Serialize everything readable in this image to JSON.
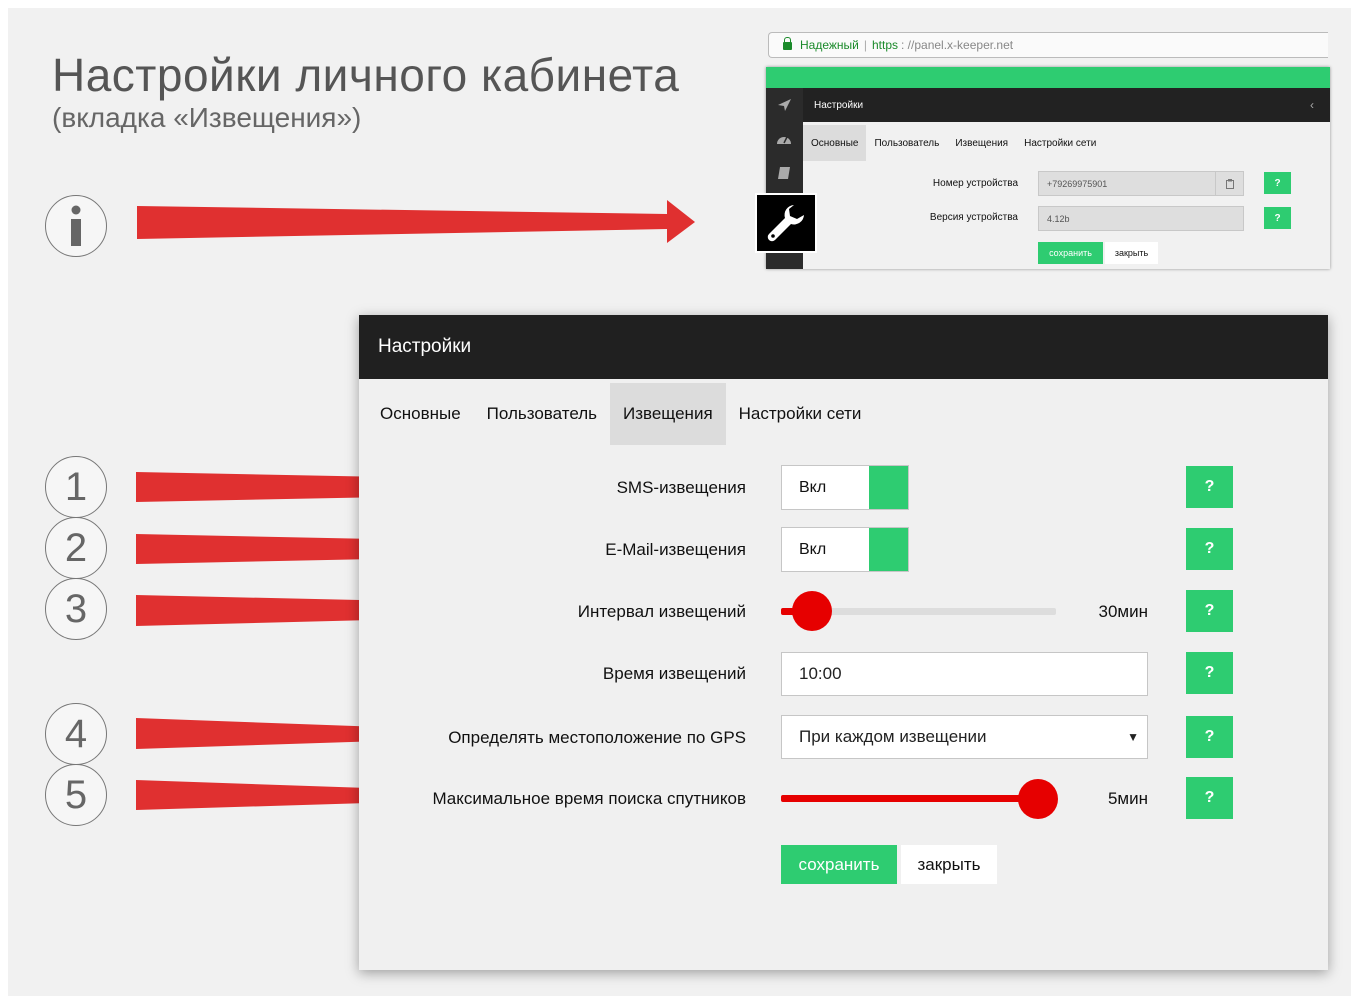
{
  "heading": {
    "title": "Настройки личного кабинета",
    "subtitle": "(вкладка «Извещения»)"
  },
  "markers": {
    "info": "i",
    "steps": [
      "1",
      "2",
      "3",
      "4",
      "5"
    ]
  },
  "browser": {
    "secure_label": "Надежный",
    "separator": "|",
    "protocol": "https",
    "host": ": //panel.x-keeper.net"
  },
  "mini_panel": {
    "title": "Настройки",
    "tabs": [
      {
        "label": "Основные",
        "active": true
      },
      {
        "label": "Пользователь",
        "active": false
      },
      {
        "label": "Извещения",
        "active": false
      },
      {
        "label": "Настройки сети",
        "active": false
      }
    ],
    "device_number_label": "Номер устройства",
    "device_number_value": "+79269975901",
    "device_version_label": "Версия устройства",
    "device_version_value": "4.12b",
    "help_label": "?",
    "save_label": "сохранить",
    "close_label": "закрыть"
  },
  "panel": {
    "title": "Настройки",
    "tabs": [
      {
        "label": "Основные",
        "active": false
      },
      {
        "label": "Пользователь",
        "active": false
      },
      {
        "label": "Извещения",
        "active": true
      },
      {
        "label": "Настройки сети",
        "active": false
      }
    ],
    "sms": {
      "label": "SMS-извещения",
      "value": "Вкл"
    },
    "email": {
      "label": "E-Mail-извещения",
      "value": "Вкл"
    },
    "interval": {
      "label": "Интервал извещений",
      "value_text": "30мин",
      "level": 0.0
    },
    "time": {
      "label": "Время извещений",
      "value": "10:00"
    },
    "gps": {
      "label": "Определять местоположение по GPS",
      "selected": "При каждом извещении"
    },
    "max_search": {
      "label": "Максимальное время поиска спутников",
      "value_text": "5мин",
      "level": 1.0
    },
    "help_label": "?",
    "save_label": "сохранить",
    "close_label": "закрыть"
  },
  "colors": {
    "accent_green": "#2ecc71",
    "slider_red": "#e60000",
    "arrow_red": "#e03030",
    "header_dark": "#202020"
  }
}
